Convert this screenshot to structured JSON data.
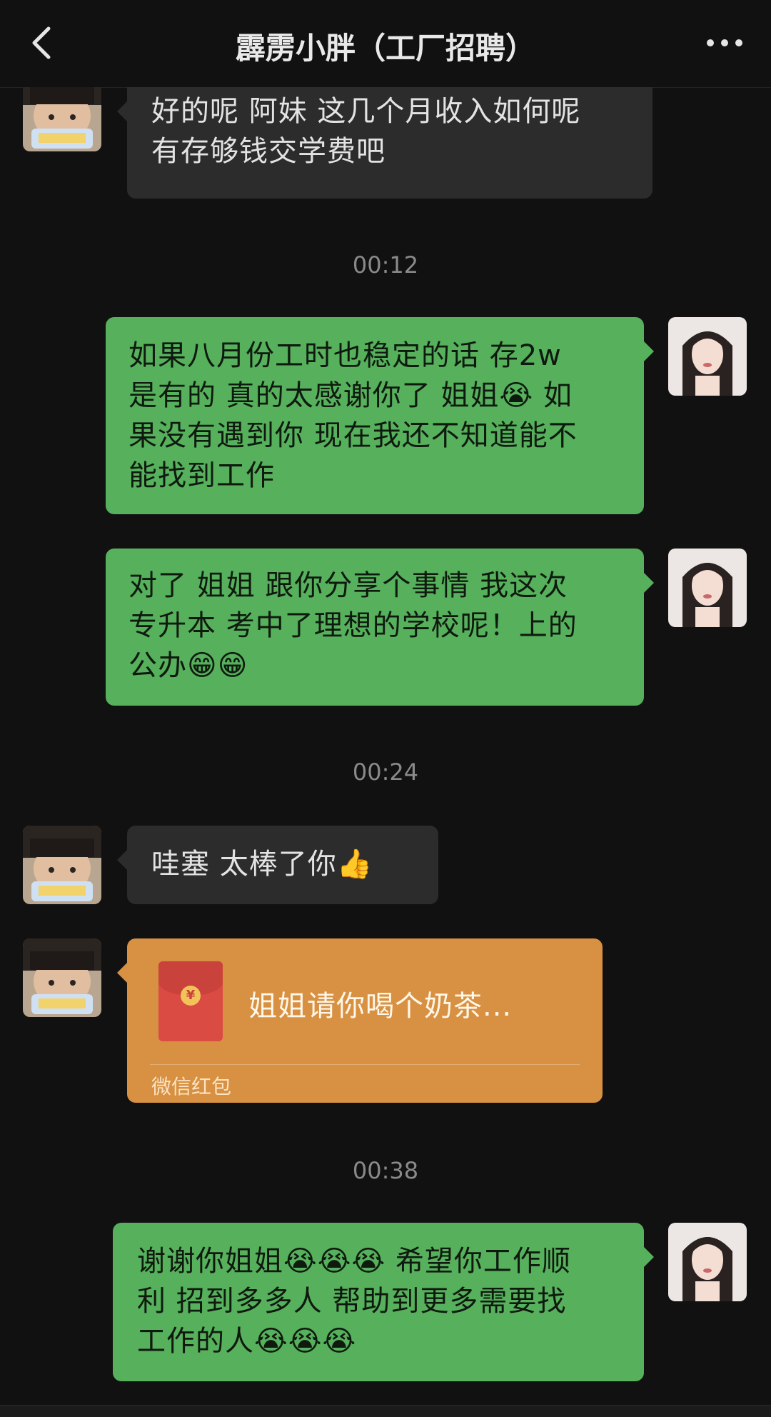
{
  "header": {
    "title": "霹雳小胖（工厂招聘）",
    "back_icon": "chevron-left-icon",
    "more_icon": "more-dots-icon"
  },
  "messages": [
    {
      "side": "left",
      "lines": [
        "好的呢 阿妹 这几个月收入如何呢",
        "有存够钱交学费吧"
      ]
    },
    {
      "type": "timestamp",
      "text": "00:12"
    },
    {
      "side": "right",
      "lines": [
        "如果八月份工时也稳定的话 存2w",
        "是有的 真的太感谢你了 姐姐",
        "果没有遇到你 现在我还不知道能不",
        "能找到工作"
      ],
      "inline_emoji": "😭",
      "line2_suffix": " 如"
    },
    {
      "side": "right",
      "lines": [
        "对了 姐姐 跟你分享个事情 我这次",
        "专升本 考中了理想的学校呢！上的",
        "公办"
      ],
      "emoji_end": "😁😁"
    },
    {
      "type": "timestamp",
      "text": "00:24"
    },
    {
      "side": "left",
      "lines": [
        "哇塞 太棒了你"
      ],
      "emoji_end": "👍"
    },
    {
      "type": "redpacket",
      "text": "姐姐请你喝个奶茶...",
      "label": "微信红包",
      "coin": "¥"
    },
    {
      "type": "timestamp",
      "text": "00:38"
    },
    {
      "side": "right",
      "lines": [
        "谢谢你姐姐",
        "利 招到多多人 帮助到更多需要找",
        "工作的人"
      ],
      "line1_emoji": "😭😭😭",
      "line1_suffix": " 希望你工作顺",
      "line3_emoji": "😭😭😭"
    }
  ],
  "colors": {
    "background": "#111111",
    "bubble_left": "#2c2c2c",
    "bubble_right": "#56b05c",
    "redpacket": "#d89142",
    "timestamp": "#8a8a8a"
  }
}
